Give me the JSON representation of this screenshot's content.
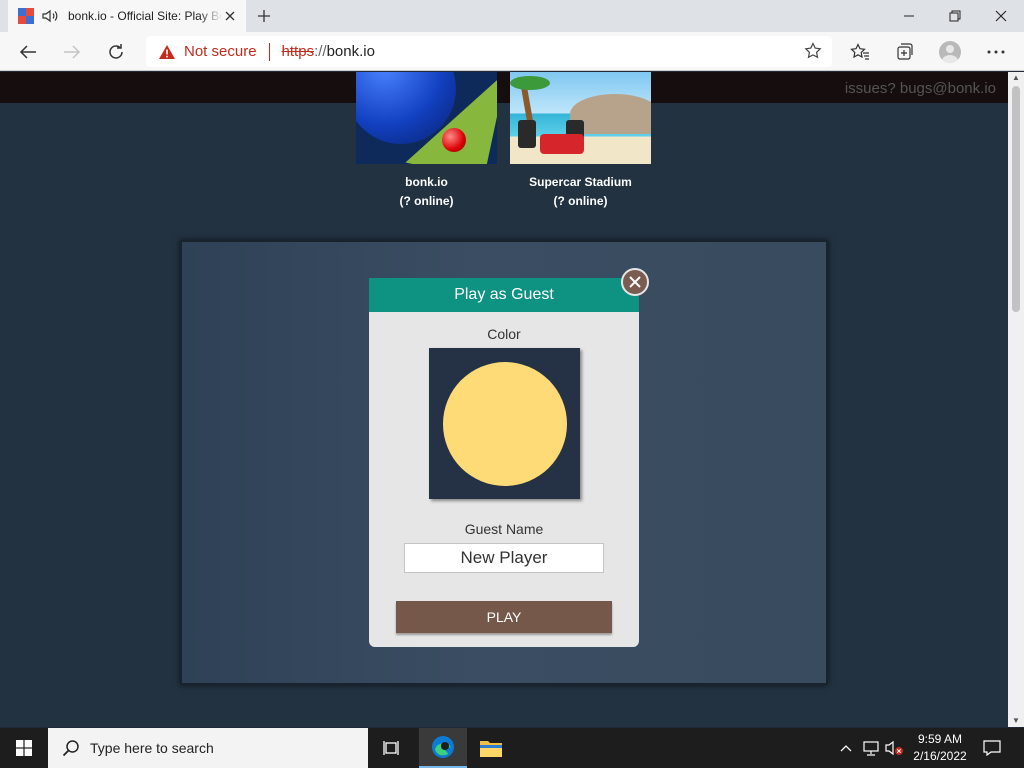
{
  "browser": {
    "tab_title": "bonk.io - Official Site: Play Bonk",
    "address": {
      "security": "Not secure",
      "scheme": "https",
      "separator": "://",
      "host": "bonk.io"
    }
  },
  "page": {
    "issues_text": "issues? bugs@bonk.io",
    "games": [
      {
        "name": "bonk.io",
        "online": "(? online)"
      },
      {
        "name": "Supercar Stadium",
        "online": "(? online)"
      }
    ],
    "dialog": {
      "title": "Play as Guest",
      "color_label": "Color",
      "selected_color": "#fedb76",
      "name_label": "Guest Name",
      "name_value": "New Player",
      "play_label": "PLAY"
    }
  },
  "taskbar": {
    "search_placeholder": "Type here to search",
    "time": "9:59 AM",
    "date": "2/16/2022"
  },
  "colors": {
    "dialog_header": "#0e9282",
    "play_button": "#76584b",
    "not_secure": "#c42b1c"
  }
}
